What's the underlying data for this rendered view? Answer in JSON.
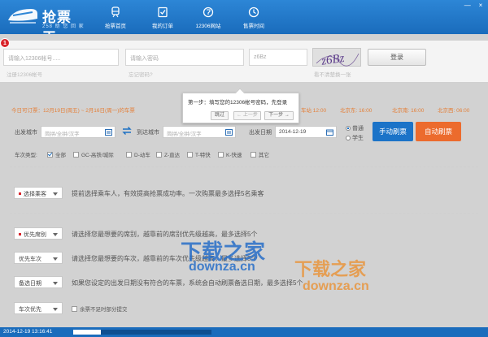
{
  "app": {
    "title": "抢票王",
    "subtitle": "258 助 您 回 家",
    "nav": [
      {
        "label": "抢票首页",
        "icon": "train-icon"
      },
      {
        "label": "我的订单",
        "icon": "checklist-icon"
      },
      {
        "label": "12306网站",
        "icon": "globe-icon"
      },
      {
        "label": "售票时间",
        "icon": "clock-icon"
      }
    ],
    "window_buttons": [
      "—",
      "×"
    ]
  },
  "login": {
    "account_placeholder": "请输入12306帐号.....",
    "password_placeholder": "请输入密码",
    "captcha_value": "z6Bz",
    "captcha_image_text": "z6Bz",
    "login_label": "登录",
    "hint_register": "注册12306帐号",
    "hint_forgot": "忘记密码?",
    "hint_refresh": "看不清楚换一张",
    "step_badge": "1"
  },
  "tooltip": {
    "message": "第一步：填写您的12306帐号密码，先登录",
    "skip_label": "跳过",
    "prev_label": "← 上一步",
    "next_label": "下一步 →"
  },
  "notice": {
    "left": "今日可订票：12月19日(周五) ~ 2月16日(周一)的车票",
    "right_1": "车站 12:00",
    "right_2": "北京东: 16:00",
    "right_3": "北京南: 16:00",
    "right_4": "北京西: 06:00"
  },
  "search": {
    "from_label": "出发城市",
    "from_placeholder": "简拼/全拼/汉字",
    "to_label": "到达城市",
    "to_placeholder": "简拼/全拼/汉字",
    "date_label": "出发日期",
    "date_value": "2014-12-19",
    "radio_normal": "普通",
    "radio_student": "学生",
    "manual_label": "手动刷票",
    "auto_label": "自动刷票",
    "colors": {
      "manual": "#1b73c8",
      "auto": "#ec6b2d"
    }
  },
  "train_types": {
    "label": "车次类型:",
    "options": [
      {
        "label": "全部",
        "checked": true
      },
      {
        "label": "GC-高铁/城际",
        "checked": false
      },
      {
        "label": "D-动车",
        "checked": false
      },
      {
        "label": "Z-直达",
        "checked": false
      },
      {
        "label": "T-特快",
        "checked": false
      },
      {
        "label": "K-快速",
        "checked": false
      },
      {
        "label": "其它",
        "checked": false
      }
    ]
  },
  "options": {
    "passenger_btn": "选择乘客",
    "passenger_desc": "提前选择乘车人，有效提高抢票成功率。一次购票最多选择5名乘客",
    "seat_btn": "优先席别",
    "seat_desc": "请选择您最想要的席别，越靠前的席别优先级越高，最多选择5个",
    "train_btn": "优先车次",
    "train_desc": "请选择您最想要的车次，越靠前的车次优先级越高，最多选择5个",
    "date_btn": "备选日期",
    "date_desc": "如果您设定的出发日期没有符合的车票，系统会自动刷票备选日期，最多选择5个",
    "priority_btn": "车次优先",
    "partial_label": "余票不足时部分提交"
  },
  "watermark": {
    "cn": "下载之家",
    "en": "downza.cn"
  },
  "status": {
    "timestamp": "2014-12-19 13:16:41",
    "progress": 0.2
  }
}
